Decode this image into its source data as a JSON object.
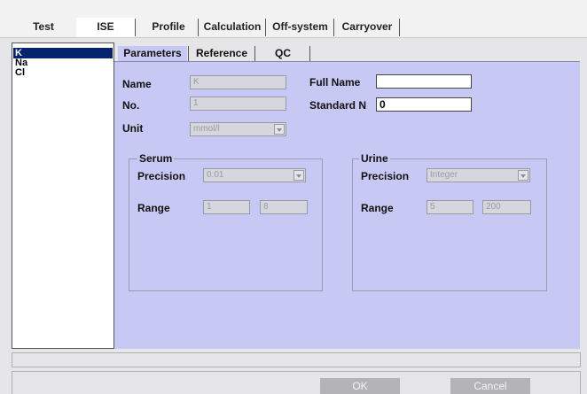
{
  "top_tabs": [
    {
      "label": "Test"
    },
    {
      "label": "ISE"
    },
    {
      "label": "Profile"
    },
    {
      "label": "Calculation"
    },
    {
      "label": "Off-system"
    },
    {
      "label": "Carryover"
    }
  ],
  "list": {
    "items": [
      {
        "label": "K"
      },
      {
        "label": "Na"
      },
      {
        "label": "Cl"
      }
    ],
    "selected": "K"
  },
  "sub_tabs": [
    {
      "label": "Parameters"
    },
    {
      "label": "Reference"
    },
    {
      "label": "QC"
    }
  ],
  "parameters": {
    "name_label": "Name",
    "name_value": "K",
    "no_label": "No.",
    "no_value": "1",
    "unit_label": "Unit",
    "unit_value": "mmol/l",
    "full_name_label": "Full Name",
    "full_name_value": "",
    "standard_label": "Standard N",
    "standard_value": "0"
  },
  "serum": {
    "title": "Serum",
    "precision_label": "Precision",
    "precision_value": "0.01",
    "range_label": "Range",
    "range_low": "1",
    "range_high": "8"
  },
  "urine": {
    "title": "Urine",
    "precision_label": "Precision",
    "precision_value": "Integer",
    "range_label": "Range",
    "range_low": "5",
    "range_high": "200"
  },
  "buttons": {
    "ok": "OK",
    "cancel": "Cancel"
  },
  "colors": {
    "panel": "#c8c8f4",
    "selection": "#06246e",
    "disabled_field": "#d6d6de"
  }
}
